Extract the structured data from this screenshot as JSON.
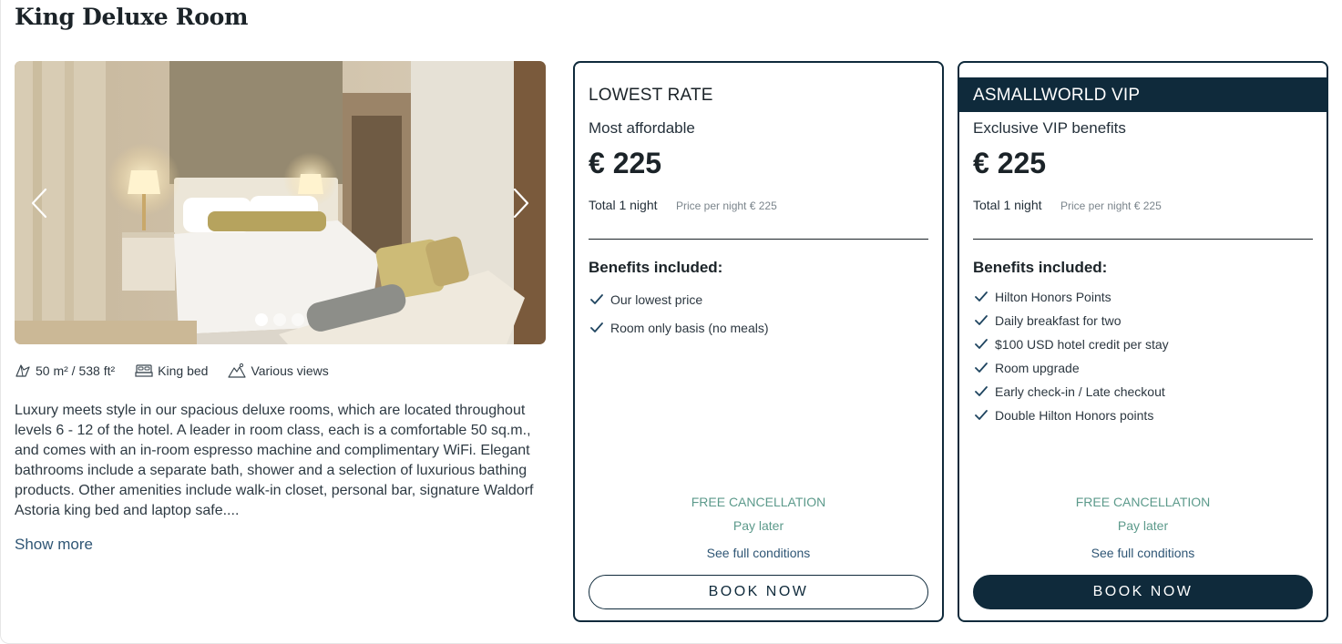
{
  "room": {
    "title": "King Deluxe Room",
    "amenities": [
      {
        "icon": "area-icon",
        "label": "50 m² / 538 ft²"
      },
      {
        "icon": "bed-icon",
        "label": "King bed"
      },
      {
        "icon": "mountain-view-icon",
        "label": "Various views"
      }
    ],
    "description": "Luxury meets style in our spacious deluxe rooms, which are located throughout levels 6 - 12 of the hotel. A leader in room class, each is a comfortable 50 sq.m., and comes with an in-room espresso machine and complimentary WiFi. Elegant bathrooms include a separate bath, shower and a selection of luxurious bathing products. Other amenities include walk-in closet, personal bar, signature Waldorf Astoria king bed and laptop safe....",
    "show_more": "Show more",
    "gallery": {
      "slide_count": 3,
      "active_slide": 1
    }
  },
  "rates": [
    {
      "name": "LOWEST RATE",
      "subtitle": "Most affordable",
      "price": "€ 225",
      "total": "Total 1 night",
      "per_night": "Price per night € 225",
      "benefits_title": "Benefits included:",
      "benefits": [
        "Our lowest price",
        "Room only basis (no meals)"
      ],
      "cancellation": "FREE CANCELLATION",
      "payment": "Pay later",
      "conditions": "See full conditions",
      "book": "BOOK NOW"
    },
    {
      "name": "ASMALLWORLD VIP",
      "subtitle": "Exclusive VIP benefits",
      "price": "€ 225",
      "total": "Total 1 night",
      "per_night": "Price per night € 225",
      "benefits_title": "Benefits included:",
      "benefits": [
        "Hilton Honors Points",
        "Daily breakfast for two",
        "$100 USD hotel credit per stay",
        "Room upgrade",
        "Early check-in / Late checkout",
        "Double Hilton Honors points"
      ],
      "cancellation": "FREE CANCELLATION",
      "payment": "Pay later",
      "conditions": "See full conditions",
      "book": "BOOK NOW"
    }
  ],
  "colors": {
    "navy": "#0f2a3b",
    "teal": "#5c9a8b",
    "link": "#2f5675"
  }
}
